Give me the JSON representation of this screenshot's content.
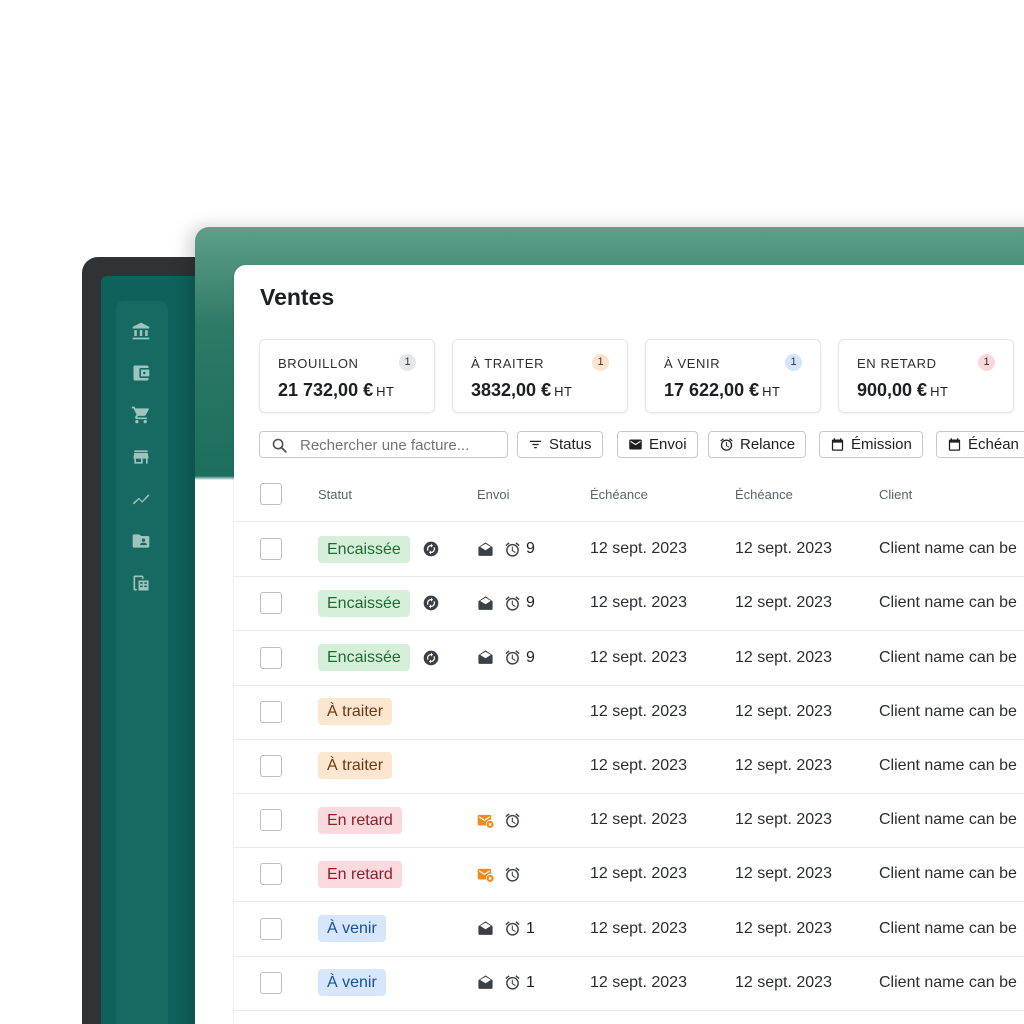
{
  "app": {
    "title": "Ventes",
    "accent_color": "#1c6e5d",
    "sidebar_color": "#0f625b"
  },
  "sidebar": {
    "items": [
      {
        "icon": "bank-icon"
      },
      {
        "icon": "wallet-icon"
      },
      {
        "icon": "cart-icon"
      },
      {
        "icon": "store-icon"
      },
      {
        "icon": "trending-icon"
      },
      {
        "icon": "contact-folder-icon"
      },
      {
        "icon": "spreadsheet-icon"
      }
    ]
  },
  "summary_cards": [
    {
      "label": "BROUILLON",
      "count": "1",
      "amount": "21 732,00 €",
      "unit": "HT",
      "count_color": "#e6e7e9"
    },
    {
      "label": "À TRAITER",
      "count": "1",
      "amount": "3832,00 €",
      "unit": "HT",
      "count_color": "#fde3cc"
    },
    {
      "label": "À VENIR",
      "count": "1",
      "amount": "17 622,00 €",
      "unit": "HT",
      "count_color": "#d3e4fd"
    },
    {
      "label": "EN RETARD",
      "count": "1",
      "amount": "900,00 €",
      "unit": "HT",
      "count_color": "#fbd6db"
    }
  ],
  "toolbar": {
    "search_placeholder": "Rechercher une facture...",
    "filters": [
      {
        "label": "Status",
        "icon": "filter-icon"
      },
      {
        "label": "Envoi",
        "icon": "mail-icon"
      },
      {
        "label": "Relance",
        "icon": "alarm-icon"
      },
      {
        "label": "Émission",
        "icon": "calendar-icon"
      },
      {
        "label": "Échéan",
        "icon": "calendar-icon"
      }
    ]
  },
  "table": {
    "columns": [
      "Statut",
      "Envoi",
      "Échéance",
      "Échéance",
      "Client"
    ],
    "rows": [
      {
        "status": "Encaissée",
        "kind": "encaissee",
        "synced": true,
        "mail": "read",
        "alarm": true,
        "relances": "9",
        "date1": "12 sept. 2023",
        "date2": "12 sept. 2023",
        "client": "Client name can be"
      },
      {
        "status": "Encaissée",
        "kind": "encaissee",
        "synced": true,
        "mail": "read",
        "alarm": true,
        "relances": "9",
        "date1": "12 sept. 2023",
        "date2": "12 sept. 2023",
        "client": "Client name can be"
      },
      {
        "status": "Encaissée",
        "kind": "encaissee",
        "synced": true,
        "mail": "read",
        "alarm": true,
        "relances": "9",
        "date1": "12 sept. 2023",
        "date2": "12 sept. 2023",
        "client": "Client name can be"
      },
      {
        "status": "À traiter",
        "kind": "atraiter",
        "synced": false,
        "mail": "none",
        "alarm": false,
        "relances": "",
        "date1": "12 sept. 2023",
        "date2": "12 sept. 2023",
        "client": "Client name can be"
      },
      {
        "status": "À traiter",
        "kind": "atraiter",
        "synced": false,
        "mail": "none",
        "alarm": false,
        "relances": "",
        "date1": "12 sept. 2023",
        "date2": "12 sept. 2023",
        "client": "Client name can be"
      },
      {
        "status": "En retard",
        "kind": "retard",
        "synced": false,
        "mail": "error",
        "alarm": true,
        "relances": "",
        "date1": "12 sept. 2023",
        "date2": "12 sept. 2023",
        "client": "Client name can be"
      },
      {
        "status": "En retard",
        "kind": "retard",
        "synced": false,
        "mail": "error",
        "alarm": true,
        "relances": "",
        "date1": "12 sept. 2023",
        "date2": "12 sept. 2023",
        "client": "Client name can be"
      },
      {
        "status": "À venir",
        "kind": "avenir",
        "synced": false,
        "mail": "read",
        "alarm": true,
        "relances": "1",
        "date1": "12 sept. 2023",
        "date2": "12 sept. 2023",
        "client": "Client name can be"
      },
      {
        "status": "À venir",
        "kind": "avenir",
        "synced": false,
        "mail": "read",
        "alarm": true,
        "relances": "1",
        "date1": "12 sept. 2023",
        "date2": "12 sept. 2023",
        "client": "Client name can be"
      }
    ]
  }
}
